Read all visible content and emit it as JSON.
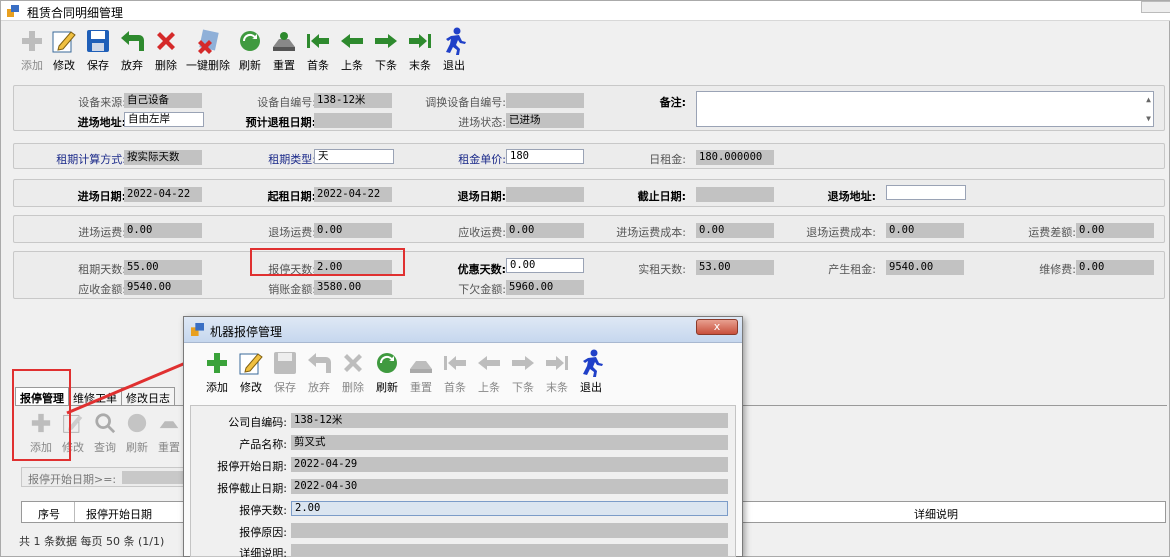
{
  "window": {
    "title": "租赁合同明细管理"
  },
  "toolbar": {
    "buttons": [
      {
        "label": "添加",
        "icon": "plus-icon",
        "disabled": true
      },
      {
        "label": "修改",
        "icon": "edit-icon"
      },
      {
        "label": "保存",
        "icon": "save-icon"
      },
      {
        "label": "放弃",
        "icon": "undo-icon"
      },
      {
        "label": "删除",
        "icon": "delete-icon"
      },
      {
        "label": "一键删除",
        "icon": "batch-delete-icon"
      },
      {
        "label": "刷新",
        "icon": "refresh-icon"
      },
      {
        "label": "重置",
        "icon": "reset-icon"
      },
      {
        "label": "首条",
        "icon": "first-icon"
      },
      {
        "label": "上条",
        "icon": "prev-icon"
      },
      {
        "label": "下条",
        "icon": "next-icon"
      },
      {
        "label": "末条",
        "icon": "last-icon"
      },
      {
        "label": "退出",
        "icon": "exit-icon"
      }
    ]
  },
  "panel1": {
    "source_label": "设备来源:",
    "source_value": "自己设备",
    "selfno_label": "设备自编号:",
    "selfno_value": "138-12米",
    "swapno_label": "调换设备自编号:",
    "swapno_value": "",
    "remark_label": "备注:",
    "addr_label": "进场地址:",
    "addr_value": "自由左岸",
    "plan_return_label": "预计退租日期:",
    "plan_return_value": "",
    "status_label": "进场状态:",
    "status_value": "已进场"
  },
  "panel2": {
    "calc_label": "租期计算方式:",
    "calc_value": "按实际天数",
    "type_label": "租期类型:",
    "type_value": "天",
    "price_label": "租金单价:",
    "price_value": "180",
    "daily_label": "日租金:",
    "daily_value": "180.000000"
  },
  "panel3": {
    "enter_label": "进场日期:",
    "enter_value": "2022-04-22",
    "start_label": "起租日期:",
    "start_value": "2022-04-22",
    "exit_label": "退场日期:",
    "exit_value": "",
    "cut_label": "截止日期:",
    "cut_value": "",
    "exit_addr_label": "退场地址:",
    "exit_addr_value": ""
  },
  "panel4": {
    "in_fee_label": "进场运费:",
    "in_fee_value": "0.00",
    "out_fee_label": "退场运费:",
    "out_fee_value": "0.00",
    "recv_fee_label": "应收运费:",
    "recv_fee_value": "0.00",
    "in_cost_label": "进场运费成本:",
    "in_cost_value": "0.00",
    "out_cost_label": "退场运费成本:",
    "out_cost_value": "0.00",
    "diff_label": "运费差额:",
    "diff_value": "0.00"
  },
  "panel5": {
    "days_label": "租期天数:",
    "days_value": "55.00",
    "stop_label": "报停天数:",
    "stop_value": "2.00",
    "discount_label": "优惠天数:",
    "discount_value": "0.00",
    "actual_label": "实租天数:",
    "actual_value": "53.00",
    "rent_label": "产生租金:",
    "rent_value": "9540.00",
    "repair_label": "维修费:",
    "repair_value": "0.00",
    "due_label": "应收金额:",
    "due_value": "9540.00",
    "paid_label": "销账金额:",
    "paid_value": "3580.00",
    "owe_label": "下欠金额:",
    "owe_value": "5960.00"
  },
  "tabs": [
    "报停管理",
    "维修工单",
    "修改日志"
  ],
  "sub_toolbar": [
    "添加",
    "修改",
    "查询",
    "刷新",
    "重置"
  ],
  "filter_label": "报停开始日期>=:",
  "grid": {
    "col_no": "序号",
    "col_start": "报停开始日期",
    "col_detail": "详细说明"
  },
  "status_text": "共 1 条数据  每页 50 条  (1/1)",
  "dialog": {
    "title": "机器报停管理",
    "close": "x",
    "toolbar": [
      {
        "label": "添加",
        "icon": "plus-icon"
      },
      {
        "label": "修改",
        "icon": "edit-icon"
      },
      {
        "label": "保存",
        "icon": "save-icon",
        "disabled": true
      },
      {
        "label": "放弃",
        "icon": "undo-icon",
        "disabled": true
      },
      {
        "label": "删除",
        "icon": "delete-icon",
        "disabled": true
      },
      {
        "label": "刷新",
        "icon": "refresh-icon"
      },
      {
        "label": "重置",
        "icon": "reset-icon",
        "disabled": true
      },
      {
        "label": "首条",
        "icon": "first-icon",
        "disabled": true
      },
      {
        "label": "上条",
        "icon": "prev-icon",
        "disabled": true
      },
      {
        "label": "下条",
        "icon": "next-icon",
        "disabled": true
      },
      {
        "label": "末条",
        "icon": "last-icon",
        "disabled": true
      },
      {
        "label": "退出",
        "icon": "exit-icon"
      }
    ],
    "fields": [
      {
        "label": "公司自编码:",
        "value": "138-12米"
      },
      {
        "label": "产品名称:",
        "value": "剪叉式"
      },
      {
        "label": "报停开始日期:",
        "value": "2022-04-29"
      },
      {
        "label": "报停截止日期:",
        "value": "2022-04-30"
      },
      {
        "label": "报停天数:",
        "value": "2.00"
      },
      {
        "label": "报停原因:",
        "value": ""
      },
      {
        "label": "详细说明:",
        "value": ""
      }
    ]
  }
}
